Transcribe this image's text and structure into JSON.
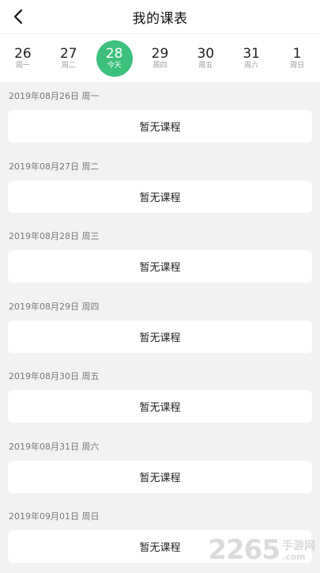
{
  "header": {
    "title": "我的课表",
    "back_icon": "chevron-left-icon"
  },
  "datebar": {
    "accent": "#3cc07b",
    "days": [
      {
        "num": "26",
        "week": "周一",
        "active": false
      },
      {
        "num": "27",
        "week": "周二",
        "active": false
      },
      {
        "num": "28",
        "week": "今天",
        "active": true
      },
      {
        "num": "29",
        "week": "周四",
        "active": false
      },
      {
        "num": "30",
        "week": "周五",
        "active": false
      },
      {
        "num": "31",
        "week": "周六",
        "active": false
      },
      {
        "num": "1",
        "week": "周日",
        "active": false
      }
    ]
  },
  "schedule": [
    {
      "date": "2019年08月26日 周一",
      "content": "暂无课程"
    },
    {
      "date": "2019年08月27日 周二",
      "content": "暂无课程"
    },
    {
      "date": "2019年08月28日 周三",
      "content": "暂无课程"
    },
    {
      "date": "2019年08月29日 周四",
      "content": "暂无课程"
    },
    {
      "date": "2019年08月30日 周五",
      "content": "暂无课程"
    },
    {
      "date": "2019年08月31日 周六",
      "content": "暂无课程"
    },
    {
      "date": "2019年09月01日 周日",
      "content": "暂无课程"
    }
  ],
  "watermark": {
    "number": "2265",
    "cn": "手游网",
    "com": ".com"
  }
}
